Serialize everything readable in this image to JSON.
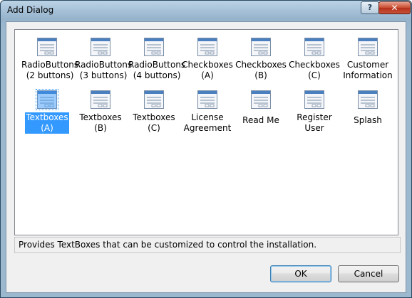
{
  "window": {
    "title": "Add Dialog",
    "help_label": "?",
    "close_label": "✕"
  },
  "dialogs": [
    {
      "label": "RadioButtons (2 buttons)",
      "line1": "RadioButtons",
      "line2": "(2 buttons)",
      "selected": false
    },
    {
      "label": "RadioButtons (3 buttons)",
      "line1": "RadioButtons",
      "line2": "(3 buttons)",
      "selected": false
    },
    {
      "label": "RadioButtons (4 buttons)",
      "line1": "RadioButtons",
      "line2": "(4 buttons)",
      "selected": false
    },
    {
      "label": "Checkboxes (A)",
      "line1": "Checkboxes",
      "line2": "(A)",
      "selected": false
    },
    {
      "label": "Checkboxes (B)",
      "line1": "Checkboxes",
      "line2": "(B)",
      "selected": false
    },
    {
      "label": "Checkboxes (C)",
      "line1": "Checkboxes",
      "line2": "(C)",
      "selected": false
    },
    {
      "label": "Customer Information",
      "line1": "Customer",
      "line2": "Information",
      "selected": false
    },
    {
      "label": "Textboxes (A)",
      "line1": "Textboxes",
      "line2": "(A)",
      "selected": true
    },
    {
      "label": "Textboxes (B)",
      "line1": "Textboxes",
      "line2": "(B)",
      "selected": false
    },
    {
      "label": "Textboxes (C)",
      "line1": "Textboxes",
      "line2": "(C)",
      "selected": false
    },
    {
      "label": "License Agreement",
      "line1": "License",
      "line2": "Agreement",
      "selected": false
    },
    {
      "label": "Read Me",
      "line1": "Read Me",
      "line2": "",
      "selected": false
    },
    {
      "label": "Register User",
      "line1": "Register User",
      "line2": "",
      "selected": false
    },
    {
      "label": "Splash",
      "line1": "Splash",
      "line2": "",
      "selected": false
    }
  ],
  "description": "Provides TextBoxes that can be customized to control the installation.",
  "buttons": {
    "ok": "OK",
    "cancel": "Cancel"
  },
  "icon": "dialog-template-icon",
  "colors": {
    "selection": "#3399ff",
    "icon_header": "#4a7fc0"
  }
}
